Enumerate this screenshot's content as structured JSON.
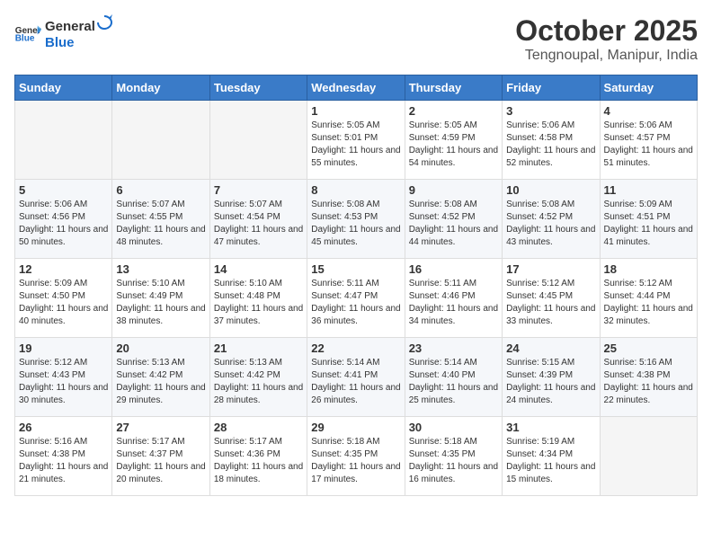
{
  "header": {
    "logo_general": "General",
    "logo_blue": "Blue",
    "month_title": "October 2025",
    "location": "Tengnoupal, Manipur, India"
  },
  "weekdays": [
    "Sunday",
    "Monday",
    "Tuesday",
    "Wednesday",
    "Thursday",
    "Friday",
    "Saturday"
  ],
  "days": [
    {
      "date": null,
      "empty": true
    },
    {
      "date": null,
      "empty": true
    },
    {
      "date": null,
      "empty": true
    },
    {
      "date": "1",
      "sunrise": "Sunrise: 5:05 AM",
      "sunset": "Sunset: 5:01 PM",
      "daylight": "Daylight: 11 hours and 55 minutes."
    },
    {
      "date": "2",
      "sunrise": "Sunrise: 5:05 AM",
      "sunset": "Sunset: 4:59 PM",
      "daylight": "Daylight: 11 hours and 54 minutes."
    },
    {
      "date": "3",
      "sunrise": "Sunrise: 5:06 AM",
      "sunset": "Sunset: 4:58 PM",
      "daylight": "Daylight: 11 hours and 52 minutes."
    },
    {
      "date": "4",
      "sunrise": "Sunrise: 5:06 AM",
      "sunset": "Sunset: 4:57 PM",
      "daylight": "Daylight: 11 hours and 51 minutes."
    },
    {
      "date": "5",
      "sunrise": "Sunrise: 5:06 AM",
      "sunset": "Sunset: 4:56 PM",
      "daylight": "Daylight: 11 hours and 50 minutes."
    },
    {
      "date": "6",
      "sunrise": "Sunrise: 5:07 AM",
      "sunset": "Sunset: 4:55 PM",
      "daylight": "Daylight: 11 hours and 48 minutes."
    },
    {
      "date": "7",
      "sunrise": "Sunrise: 5:07 AM",
      "sunset": "Sunset: 4:54 PM",
      "daylight": "Daylight: 11 hours and 47 minutes."
    },
    {
      "date": "8",
      "sunrise": "Sunrise: 5:08 AM",
      "sunset": "Sunset: 4:53 PM",
      "daylight": "Daylight: 11 hours and 45 minutes."
    },
    {
      "date": "9",
      "sunrise": "Sunrise: 5:08 AM",
      "sunset": "Sunset: 4:52 PM",
      "daylight": "Daylight: 11 hours and 44 minutes."
    },
    {
      "date": "10",
      "sunrise": "Sunrise: 5:08 AM",
      "sunset": "Sunset: 4:52 PM",
      "daylight": "Daylight: 11 hours and 43 minutes."
    },
    {
      "date": "11",
      "sunrise": "Sunrise: 5:09 AM",
      "sunset": "Sunset: 4:51 PM",
      "daylight": "Daylight: 11 hours and 41 minutes."
    },
    {
      "date": "12",
      "sunrise": "Sunrise: 5:09 AM",
      "sunset": "Sunset: 4:50 PM",
      "daylight": "Daylight: 11 hours and 40 minutes."
    },
    {
      "date": "13",
      "sunrise": "Sunrise: 5:10 AM",
      "sunset": "Sunset: 4:49 PM",
      "daylight": "Daylight: 11 hours and 38 minutes."
    },
    {
      "date": "14",
      "sunrise": "Sunrise: 5:10 AM",
      "sunset": "Sunset: 4:48 PM",
      "daylight": "Daylight: 11 hours and 37 minutes."
    },
    {
      "date": "15",
      "sunrise": "Sunrise: 5:11 AM",
      "sunset": "Sunset: 4:47 PM",
      "daylight": "Daylight: 11 hours and 36 minutes."
    },
    {
      "date": "16",
      "sunrise": "Sunrise: 5:11 AM",
      "sunset": "Sunset: 4:46 PM",
      "daylight": "Daylight: 11 hours and 34 minutes."
    },
    {
      "date": "17",
      "sunrise": "Sunrise: 5:12 AM",
      "sunset": "Sunset: 4:45 PM",
      "daylight": "Daylight: 11 hours and 33 minutes."
    },
    {
      "date": "18",
      "sunrise": "Sunrise: 5:12 AM",
      "sunset": "Sunset: 4:44 PM",
      "daylight": "Daylight: 11 hours and 32 minutes."
    },
    {
      "date": "19",
      "sunrise": "Sunrise: 5:12 AM",
      "sunset": "Sunset: 4:43 PM",
      "daylight": "Daylight: 11 hours and 30 minutes."
    },
    {
      "date": "20",
      "sunrise": "Sunrise: 5:13 AM",
      "sunset": "Sunset: 4:42 PM",
      "daylight": "Daylight: 11 hours and 29 minutes."
    },
    {
      "date": "21",
      "sunrise": "Sunrise: 5:13 AM",
      "sunset": "Sunset: 4:42 PM",
      "daylight": "Daylight: 11 hours and 28 minutes."
    },
    {
      "date": "22",
      "sunrise": "Sunrise: 5:14 AM",
      "sunset": "Sunset: 4:41 PM",
      "daylight": "Daylight: 11 hours and 26 minutes."
    },
    {
      "date": "23",
      "sunrise": "Sunrise: 5:14 AM",
      "sunset": "Sunset: 4:40 PM",
      "daylight": "Daylight: 11 hours and 25 minutes."
    },
    {
      "date": "24",
      "sunrise": "Sunrise: 5:15 AM",
      "sunset": "Sunset: 4:39 PM",
      "daylight": "Daylight: 11 hours and 24 minutes."
    },
    {
      "date": "25",
      "sunrise": "Sunrise: 5:16 AM",
      "sunset": "Sunset: 4:38 PM",
      "daylight": "Daylight: 11 hours and 22 minutes."
    },
    {
      "date": "26",
      "sunrise": "Sunrise: 5:16 AM",
      "sunset": "Sunset: 4:38 PM",
      "daylight": "Daylight: 11 hours and 21 minutes."
    },
    {
      "date": "27",
      "sunrise": "Sunrise: 5:17 AM",
      "sunset": "Sunset: 4:37 PM",
      "daylight": "Daylight: 11 hours and 20 minutes."
    },
    {
      "date": "28",
      "sunrise": "Sunrise: 5:17 AM",
      "sunset": "Sunset: 4:36 PM",
      "daylight": "Daylight: 11 hours and 18 minutes."
    },
    {
      "date": "29",
      "sunrise": "Sunrise: 5:18 AM",
      "sunset": "Sunset: 4:35 PM",
      "daylight": "Daylight: 11 hours and 17 minutes."
    },
    {
      "date": "30",
      "sunrise": "Sunrise: 5:18 AM",
      "sunset": "Sunset: 4:35 PM",
      "daylight": "Daylight: 11 hours and 16 minutes."
    },
    {
      "date": "31",
      "sunrise": "Sunrise: 5:19 AM",
      "sunset": "Sunset: 4:34 PM",
      "daylight": "Daylight: 11 hours and 15 minutes."
    },
    {
      "date": null,
      "empty": true
    }
  ]
}
